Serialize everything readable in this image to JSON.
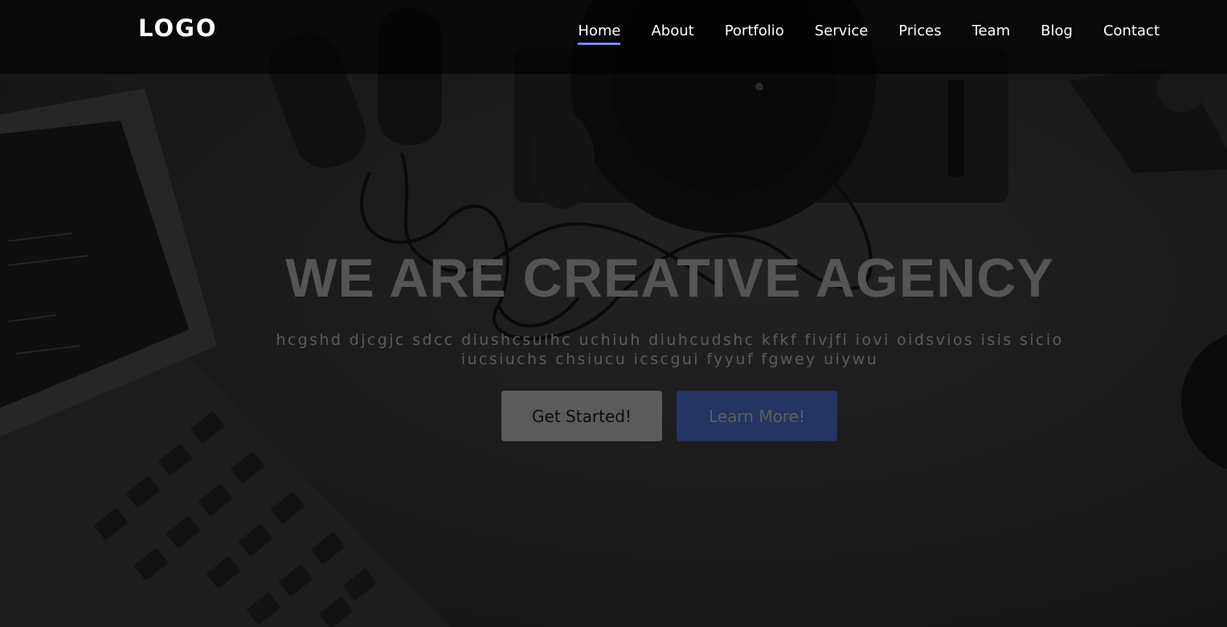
{
  "brand": {
    "logo_text": "LOGO"
  },
  "nav": {
    "items": [
      {
        "label": "Home",
        "active": true
      },
      {
        "label": "About",
        "active": false
      },
      {
        "label": "Portfolio",
        "active": false
      },
      {
        "label": "Service",
        "active": false
      },
      {
        "label": "Prices",
        "active": false
      },
      {
        "label": "Team",
        "active": false
      },
      {
        "label": "Blog",
        "active": false
      },
      {
        "label": "Contact",
        "active": false
      }
    ],
    "active_underline_color": "#6f8de8"
  },
  "hero": {
    "title": "WE ARE CREATIVE AGENCY",
    "text": "hcgshd djcgjc sdcc diushcsuihc uchiuh diuhcudshc kfkf fivjfi iovi oidsvios isis sicio iucsiuchs chsiucu icscgui fyyuf fgwey uiywu",
    "primary_button": "Get Started!",
    "secondary_button": "Learn More!"
  },
  "colors": {
    "primary_button_bg": "#5b5b5b",
    "secondary_button_bg": "#243463"
  }
}
